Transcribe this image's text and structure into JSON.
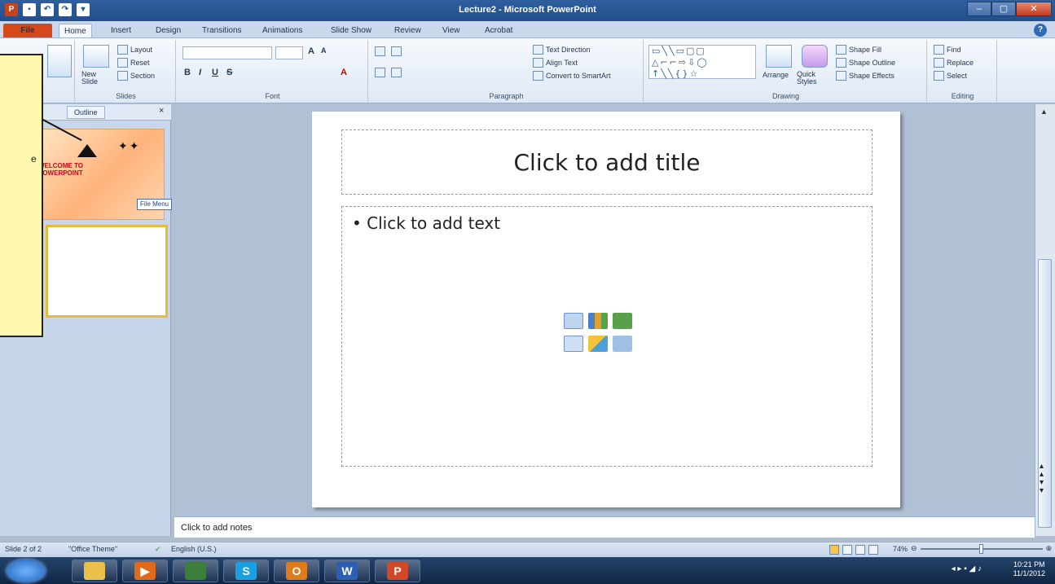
{
  "window": {
    "title": "Lecture2 - Microsoft PowerPoint",
    "min": "–",
    "max": "▢",
    "close": "✕"
  },
  "ribbon": {
    "tabs": [
      "File",
      "Home",
      "Insert",
      "Design",
      "Transitions",
      "Animations",
      "Slide Show",
      "Review",
      "View",
      "Acrobat"
    ],
    "help": "?",
    "groups": {
      "slides": {
        "label": "Slides",
        "new_slide": "New Slide",
        "layout": "Layout",
        "reset": "Reset",
        "section": "Section"
      },
      "font": {
        "label": "Font"
      },
      "paragraph": {
        "label": "Paragraph",
        "text_direction": "Text Direction",
        "align_text": "Align Text",
        "convert_smartart": "Convert to SmartArt"
      },
      "drawing": {
        "label": "Drawing",
        "arrange": "Arrange",
        "quick_styles": "Quick Styles",
        "shape_fill": "Shape Fill",
        "shape_outline": "Shape Outline",
        "shape_effects": "Shape Effects"
      },
      "editing": {
        "label": "Editing",
        "find": "Find",
        "replace": "Replace",
        "select": "Select"
      }
    }
  },
  "pane": {
    "outline_tab": "Outline",
    "close": "×",
    "thumb1": {
      "title": "WELCOME TO POWERPOINT"
    },
    "file_tag": "File Menu"
  },
  "callout": {
    "text": "e"
  },
  "slide": {
    "title_placeholder": "Click to add title",
    "body_placeholder": "Click to add text",
    "bullet": "•"
  },
  "notes": {
    "placeholder": "Click to add notes"
  },
  "statusbar": {
    "slide_info": "Slide 2 of 2",
    "theme": "\"Office Theme\"",
    "language": "English (U.S.)",
    "zoom": "74%"
  },
  "taskbar": {
    "clock_time": "10:21 PM",
    "clock_date": "11/1/2012",
    "apps": [
      {
        "label": "",
        "color": "#e8c04a"
      },
      {
        "label": "▶",
        "color": "#e06a1a"
      },
      {
        "label": "",
        "color": "#3b7f3b"
      },
      {
        "label": "S",
        "color": "#1aa0e0"
      },
      {
        "label": "O",
        "color": "#e07b1a"
      },
      {
        "label": "W",
        "color": "#2b5fb4"
      },
      {
        "label": "P",
        "color": "#d24726"
      }
    ]
  },
  "colors": {
    "file_tab": "#d4481a",
    "accent": "#2b579a",
    "callout": "#fdf7b0"
  }
}
